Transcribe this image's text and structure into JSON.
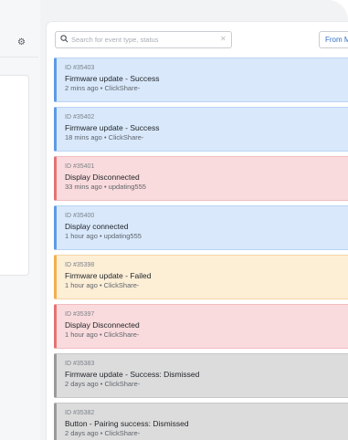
{
  "header": {
    "settings_icon": "gear-icon"
  },
  "search": {
    "placeholder": "Search for event type, status",
    "value": "",
    "icon": "search-icon",
    "clear_icon": "close-icon"
  },
  "filter": {
    "from_label": "From M"
  },
  "colors": {
    "info": "#5d9be6",
    "error": "#e57373",
    "warning": "#f0b04b",
    "dismissed": "#9a9a9a"
  },
  "events": [
    {
      "id": "ID #35403",
      "title": "Firmware update - Success",
      "meta": "2 mins ago • ClickShare-",
      "kind": "info"
    },
    {
      "id": "ID #35402",
      "title": "Firmware update - Success",
      "meta": "18 mins ago • ClickShare-",
      "kind": "info"
    },
    {
      "id": "ID #35401",
      "title": "Display Disconnected",
      "meta": "33 mins ago • updating555",
      "kind": "error"
    },
    {
      "id": "ID #35400",
      "title": "Display connected",
      "meta": "1 hour ago • updating555",
      "kind": "info"
    },
    {
      "id": "ID #35398",
      "title": "Firmware update - Failed",
      "meta": "1 hour ago • ClickShare-",
      "kind": "warning"
    },
    {
      "id": "ID #35397",
      "title": "Display Disconnected",
      "meta": "1 hour ago • ClickShare-",
      "kind": "error"
    },
    {
      "id": "ID #35383",
      "title": "Firmware update - Success: Dismissed",
      "meta": "2 days ago • ClickShare-",
      "kind": "dismissed"
    },
    {
      "id": "ID #35382",
      "title": "Button - Pairing success: Dismissed",
      "meta": "2 days ago • ClickShare-",
      "kind": "dismissed"
    }
  ]
}
